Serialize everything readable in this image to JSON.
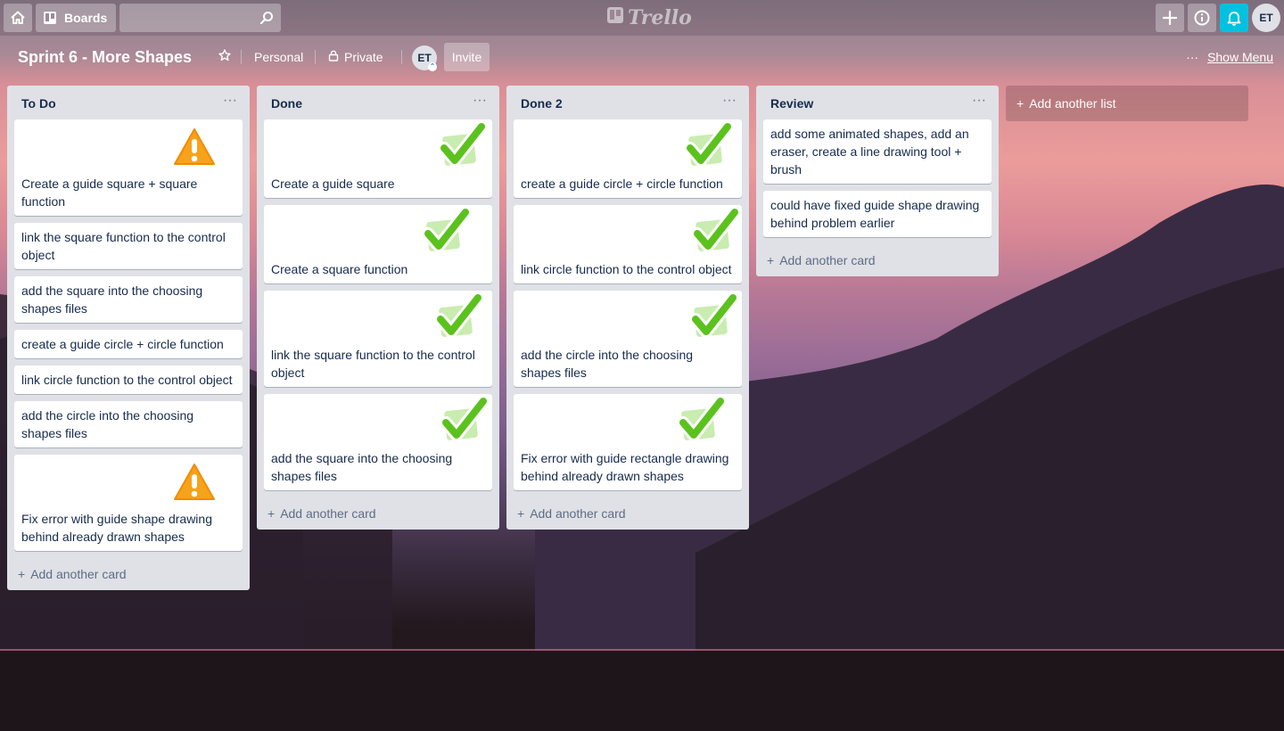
{
  "header": {
    "boards_label": "Boards",
    "search_placeholder": "",
    "logo_text": "Trello",
    "user_initials": "ET",
    "icons": {
      "home": "home-icon",
      "boards": "boards-icon",
      "search": "search-icon",
      "add": "plus-icon",
      "info": "info-icon",
      "notifications": "bell-icon"
    }
  },
  "board": {
    "title": "Sprint 6 - More Shapes",
    "team": "Personal",
    "visibility": "Private",
    "member_initials": "ET",
    "invite_label": "Invite",
    "menu_label": "Show Menu"
  },
  "lists": [
    {
      "title": "To Do",
      "cards": [
        {
          "text": "Create a guide square + square function",
          "sticker": "warning"
        },
        {
          "text": "link the square function to the control object",
          "sticker": ""
        },
        {
          "text": "add the square into the choosing shapes files",
          "sticker": ""
        },
        {
          "text": "create a guide circle + circle function",
          "sticker": ""
        },
        {
          "text": "link circle function to the control object",
          "sticker": ""
        },
        {
          "text": "add the circle into the choosing shapes files",
          "sticker": ""
        },
        {
          "text": "Fix error with guide shape drawing behind already drawn shapes",
          "sticker": "warning"
        }
      ],
      "add_card_label": "Add another card"
    },
    {
      "title": "Done",
      "cards": [
        {
          "text": "Create a guide square",
          "sticker": "check"
        },
        {
          "text": "Create a square function",
          "sticker": "check"
        },
        {
          "text": "link the square function to the control object",
          "sticker": "check"
        },
        {
          "text": "add the square into the choosing shapes files",
          "sticker": "check"
        }
      ],
      "add_card_label": "Add another card"
    },
    {
      "title": "Done 2",
      "cards": [
        {
          "text": "create a guide circle + circle function",
          "sticker": "check"
        },
        {
          "text": "link circle function to the control object",
          "sticker": "check"
        },
        {
          "text": "add the circle into the choosing shapes files",
          "sticker": "check"
        },
        {
          "text": "Fix error with guide rectangle drawing behind already drawn shapes",
          "sticker": "check"
        }
      ],
      "add_card_label": "Add another card"
    },
    {
      "title": "Review",
      "cards": [
        {
          "text": "add some animated shapes, add an eraser, create a line drawing tool + brush",
          "sticker": ""
        },
        {
          "text": "could have fixed guide shape drawing behind problem earlier",
          "sticker": ""
        }
      ],
      "add_card_label": "Add another card"
    }
  ],
  "add_list_label": "Add another list",
  "colors": {
    "accent_notification": "#00c2e0",
    "list_background": "#dfe1e6",
    "check_green": "#5bc21d",
    "warning_orange": "#f7a21b"
  }
}
